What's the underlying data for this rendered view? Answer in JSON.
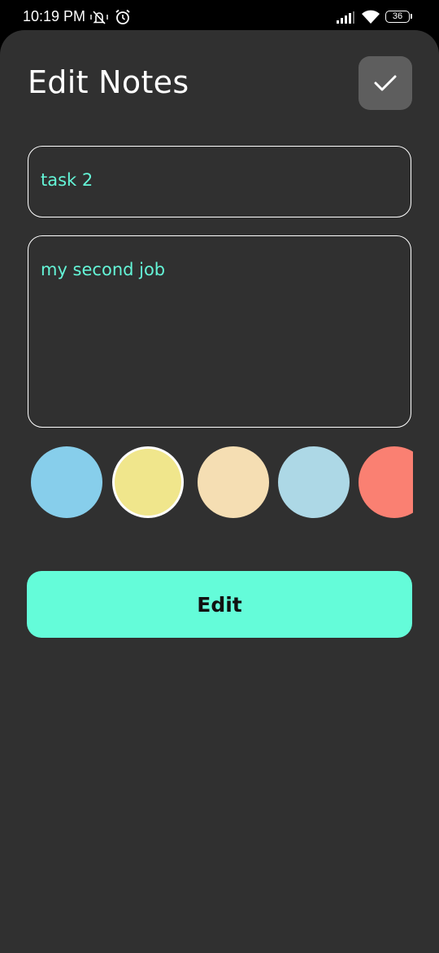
{
  "status_bar": {
    "time": "10:19 PM",
    "battery_level": "36",
    "icons": [
      "vibrate-icon",
      "alarm-icon",
      "signal-icon",
      "wifi-icon",
      "battery-icon"
    ]
  },
  "header": {
    "title": "Edit Notes",
    "confirm_icon": "check-icon"
  },
  "form": {
    "title_value": "task 2",
    "description_value": "my second job"
  },
  "colors": {
    "swatches": [
      "#87ceeb",
      "#f0e68c",
      "#f5deb3",
      "#add8e6",
      "#fa8072"
    ],
    "selected_index": 1,
    "text_accent": "#64f5d7",
    "button_bg": "#64fcd9",
    "sheet_bg": "#303030"
  },
  "actions": {
    "edit_label": "Edit"
  }
}
